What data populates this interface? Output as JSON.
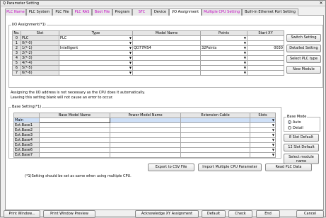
{
  "window": {
    "title": "Q Parameter Setting",
    "close_glyph": "✕"
  },
  "tabs": [
    {
      "label": "PLC Name",
      "color": "#c000c0"
    },
    {
      "label": "PLC System",
      "color": "#000000"
    },
    {
      "label": "PLC File",
      "color": "#000000"
    },
    {
      "label": "PLC RAS",
      "color": "#c000c0"
    },
    {
      "label": "Boot File",
      "color": "#c000c0"
    },
    {
      "label": "Program",
      "color": "#000000"
    },
    {
      "label": "SFC",
      "color": "#c000c0"
    },
    {
      "label": "Device",
      "color": "#000000"
    },
    {
      "label": "I/O Assignment",
      "color": "#000000"
    },
    {
      "label": "Multiple CPU Setting",
      "color": "#c000c0"
    },
    {
      "label": "Built-in Ethernet Port Setting",
      "color": "#000000"
    }
  ],
  "io_assignment": {
    "legend": "I/O Assignment(*1)",
    "headers": [
      "No.",
      "Slot",
      "Type",
      "Model Name",
      "Points",
      "Start XY"
    ],
    "rows": [
      {
        "no": "0",
        "slot": "PLC",
        "type": "PLC",
        "model": "",
        "points": "",
        "start": ""
      },
      {
        "no": "1",
        "slot": "0(*-0)",
        "type": "",
        "model": "",
        "points": "",
        "start": ""
      },
      {
        "no": "2",
        "slot": "1(*-1)",
        "type": "Intelligent",
        "model": "QD77MS4",
        "points": "32Points",
        "start": "0030"
      },
      {
        "no": "3",
        "slot": "2(*-2)",
        "type": "",
        "model": "",
        "points": "",
        "start": ""
      },
      {
        "no": "4",
        "slot": "3(*-3)",
        "type": "",
        "model": "",
        "points": "",
        "start": ""
      },
      {
        "no": "5",
        "slot": "4(*-4)",
        "type": "",
        "model": "",
        "points": "",
        "start": ""
      },
      {
        "no": "6",
        "slot": "5(*-5)",
        "type": "",
        "model": "",
        "points": "",
        "start": ""
      },
      {
        "no": "7",
        "slot": "6(*-6)",
        "type": "",
        "model": "",
        "points": "",
        "start": ""
      }
    ],
    "buttons": {
      "switch": "Switch Setting",
      "detailed": "Detailed Setting",
      "select_plc": "Select PLC type",
      "new_module": "New Module"
    }
  },
  "notes": {
    "line1": "Assigning the I/O address is not necessary as the CPU does it automatically.",
    "line2": "Leaving this setting blank will not cause an error to occur."
  },
  "base_setting": {
    "legend": "Base Setting(*1)",
    "headers": [
      "",
      "Base Model Name",
      "Power Model Name",
      "Extension Cable",
      "Slots"
    ],
    "rows": [
      "Main",
      "Ext.Base1",
      "Ext.Base2",
      "Ext.Base3",
      "Ext.Base4",
      "Ext.Base5",
      "Ext.Base6",
      "Ext.Base7"
    ]
  },
  "base_mode": {
    "legend": "Base Mode",
    "auto": "Auto",
    "detail": "Detail",
    "selected": "auto",
    "btn_8slot": "8 Slot Default",
    "btn_12slot": "12 Slot Default",
    "btn_select_module": "Select module name"
  },
  "footer_note": "(*1)Setting should be set as same when using multiple CPU.",
  "mid_buttons": {
    "export": "Export to CSV File",
    "import": "Import Multiple CPU Parameter",
    "read": "Read PLC Data"
  },
  "bottom_buttons": {
    "print_window": "Print Window...",
    "print_preview": "Print Window Preview",
    "ack": "Acknowledge XY Assignment",
    "default": "Default",
    "check": "Check",
    "end": "End",
    "cancel": "Cancel"
  }
}
